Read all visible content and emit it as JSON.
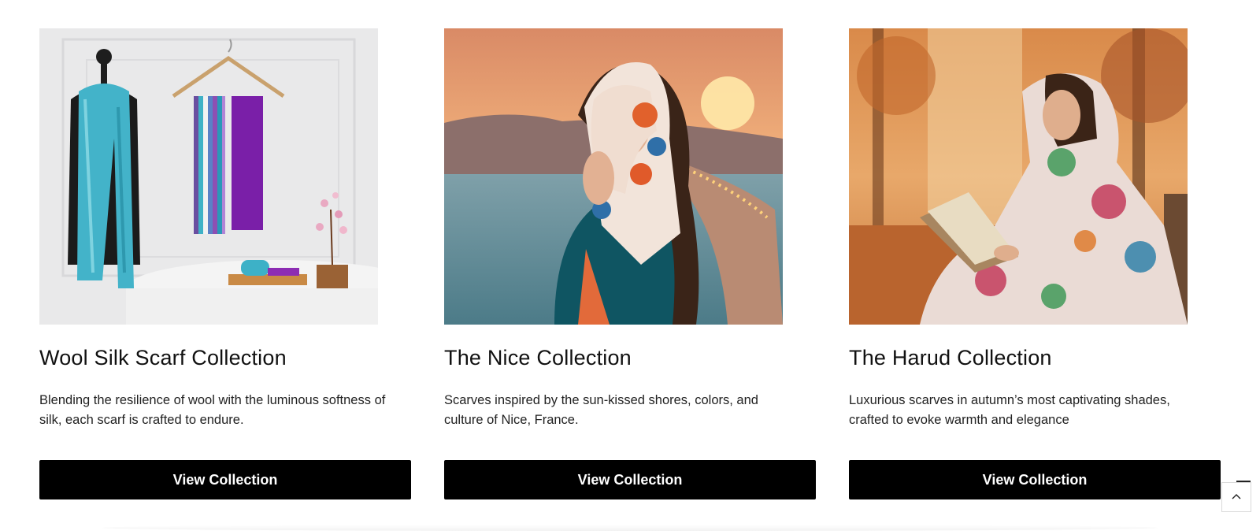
{
  "collections": [
    {
      "title": "Wool Silk Scarf Collection",
      "description": "Blending the resilience of wool with the luminous softness of silk, each scarf is crafted to endure.",
      "button_label": "View Collection",
      "image_alt": "Turquoise wool silk scarf draped on a mannequin with scarves on a hanger"
    },
    {
      "title": "The Nice Collection",
      "description": "Scarves inspired by the sun-kissed shores, colors, and culture of Nice, France.",
      "button_label": "View Collection",
      "image_alt": "Woman wearing a floral scarf at sunset by the sea in Nice"
    },
    {
      "title": "The Harud Collection",
      "description": "Luxurious scarves in autumn’s most captivating shades, crafted to evoke warmth and elegance",
      "button_label": "View Collection",
      "image_alt": "Woman in a patterned shawl reading a book on a bench in autumn"
    }
  ],
  "back_to_top": {
    "icon": "chevron-up-icon",
    "label": "Back to top"
  },
  "colors": {
    "button_bg": "#000000",
    "button_text": "#ffffff",
    "text": "#111111"
  }
}
